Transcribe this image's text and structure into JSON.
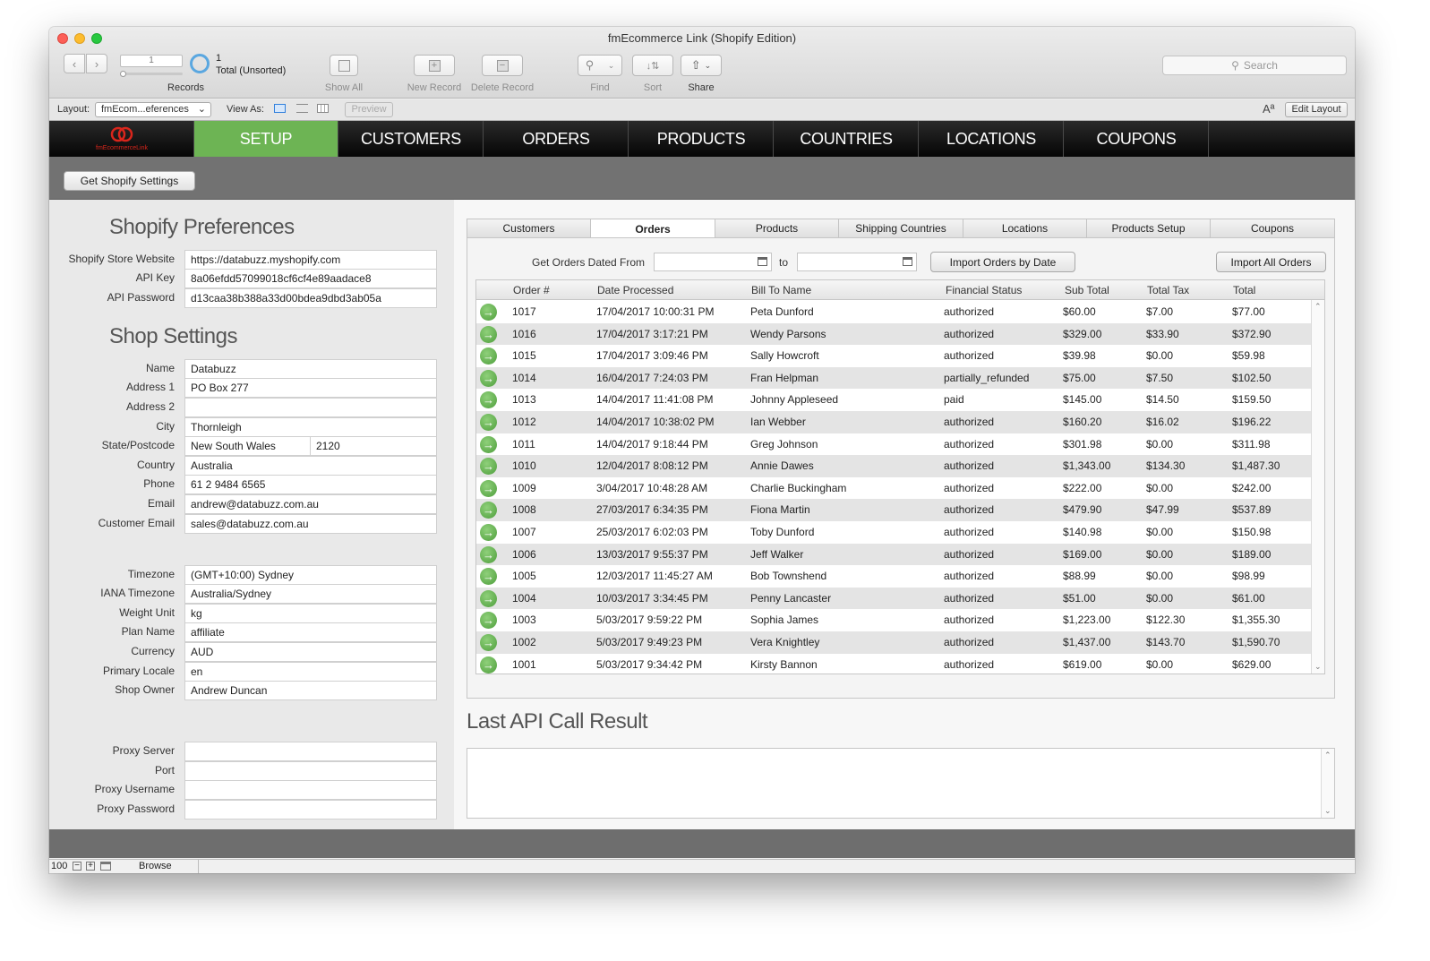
{
  "window": {
    "title": "fmEcommerce Link (Shopify Edition)"
  },
  "toolbar": {
    "record_number": "1",
    "record_count": "1",
    "record_status": "Total (Unsorted)",
    "records_label": "Records",
    "show_all_label": "Show All",
    "new_record_label": "New Record",
    "delete_record_label": "Delete Record",
    "find_label": "Find",
    "sort_label": "Sort",
    "share_label": "Share",
    "search_placeholder": "Search"
  },
  "layoutbar": {
    "layout_label": "Layout:",
    "layout_value": "fmEcom...eferences",
    "view_as_label": "View As:",
    "preview_label": "Preview",
    "text_size_icon": "Aª",
    "edit_layout_label": "Edit Layout"
  },
  "nav": {
    "logo_text": "fmEcommerceLink",
    "tabs": [
      "SETUP",
      "CUSTOMERS",
      "ORDERS",
      "PRODUCTS",
      "COUNTRIES",
      "LOCATIONS",
      "COUPONS"
    ],
    "active_tab": "SETUP",
    "active_color": "#6db454"
  },
  "subbar": {
    "get_settings_label": "Get Shopify Settings"
  },
  "preferences": {
    "heading": "Shopify Preferences",
    "fields": [
      {
        "label": "Shopify Store Website",
        "value": "https://databuzz.myshopify.com"
      },
      {
        "label": "API Key",
        "value": "8a06efdd57099018cf6cf4e89aadace8"
      },
      {
        "label": "API Password",
        "value": "d13caa38b388a33d00bdea9dbd3ab05a"
      }
    ]
  },
  "shop": {
    "heading": "Shop Settings",
    "name": {
      "label": "Name",
      "value": "Databuzz"
    },
    "address1": {
      "label": "Address 1",
      "value": "PO Box 277"
    },
    "address2": {
      "label": "Address 2",
      "value": ""
    },
    "city": {
      "label": "City",
      "value": "Thornleigh"
    },
    "state_label": "State/Postcode",
    "state": "New South Wales",
    "postcode": "2120",
    "country": {
      "label": "Country",
      "value": "Australia"
    },
    "phone": {
      "label": "Phone",
      "value": "61 2 9484 6565"
    },
    "email": {
      "label": "Email",
      "value": "andrew@databuzz.com.au"
    },
    "customer_email": {
      "label": "Customer Email",
      "value": "sales@databuzz.com.au"
    }
  },
  "locale": {
    "fields": [
      {
        "label": "Timezone",
        "value": "(GMT+10:00) Sydney"
      },
      {
        "label": "IANA Timezone",
        "value": "Australia/Sydney"
      },
      {
        "label": "Weight Unit",
        "value": "kg"
      },
      {
        "label": "Plan Name",
        "value": "affiliate"
      },
      {
        "label": "Currency",
        "value": "AUD"
      },
      {
        "label": "Primary Locale",
        "value": "en"
      },
      {
        "label": "Shop Owner",
        "value": "Andrew Duncan"
      }
    ]
  },
  "proxy": {
    "fields": [
      {
        "label": "Proxy Server",
        "value": ""
      },
      {
        "label": "Port",
        "value": ""
      },
      {
        "label": "Proxy Username",
        "value": ""
      },
      {
        "label": "Proxy Password",
        "value": ""
      }
    ]
  },
  "tabs": {
    "items": [
      "Customers",
      "Orders",
      "Products",
      "Shipping Countries",
      "Locations",
      "Products Setup",
      "Coupons"
    ],
    "active": "Orders"
  },
  "orders": {
    "date_from_label": "Get Orders Dated From",
    "date_from_value": "",
    "to_label": "to",
    "date_to_value": "",
    "import_by_date_label": "Import Orders by Date",
    "import_all_label": "Import All Orders",
    "columns": [
      "Order #",
      "Date Processed",
      "Bill To Name",
      "Financial Status",
      "Sub Total",
      "Total Tax",
      "Total"
    ],
    "rows": [
      [
        "1017",
        "17/04/2017 10:00:31 PM",
        "Peta Dunford",
        "authorized",
        "$60.00",
        "$7.00",
        "$77.00"
      ],
      [
        "1016",
        "17/04/2017 3:17:21 PM",
        "Wendy Parsons",
        "authorized",
        "$329.00",
        "$33.90",
        "$372.90"
      ],
      [
        "1015",
        "17/04/2017 3:09:46 PM",
        "Sally Howcroft",
        "authorized",
        "$39.98",
        "$0.00",
        "$59.98"
      ],
      [
        "1014",
        "16/04/2017 7:24:03 PM",
        "Fran Helpman",
        "partially_refunded",
        "$75.00",
        "$7.50",
        "$102.50"
      ],
      [
        "1013",
        "14/04/2017 11:41:08 PM",
        "Johnny Appleseed",
        "paid",
        "$145.00",
        "$14.50",
        "$159.50"
      ],
      [
        "1012",
        "14/04/2017 10:38:02 PM",
        "Ian Webber",
        "authorized",
        "$160.20",
        "$16.02",
        "$196.22"
      ],
      [
        "1011",
        "14/04/2017 9:18:44 PM",
        "Greg Johnson",
        "authorized",
        "$301.98",
        "$0.00",
        "$311.98"
      ],
      [
        "1010",
        "12/04/2017 8:08:12 PM",
        "Annie Dawes",
        "authorized",
        "$1,343.00",
        "$134.30",
        "$1,487.30"
      ],
      [
        "1009",
        "3/04/2017 10:48:28 AM",
        "Charlie Buckingham",
        "authorized",
        "$222.00",
        "$0.00",
        "$242.00"
      ],
      [
        "1008",
        "27/03/2017 6:34:35 PM",
        "Fiona Martin",
        "authorized",
        "$479.90",
        "$47.99",
        "$537.89"
      ],
      [
        "1007",
        "25/03/2017 6:02:03 PM",
        "Toby Dunford",
        "authorized",
        "$140.98",
        "$0.00",
        "$150.98"
      ],
      [
        "1006",
        "13/03/2017 9:55:37 PM",
        "Jeff Walker",
        "authorized",
        "$169.00",
        "$0.00",
        "$189.00"
      ],
      [
        "1005",
        "12/03/2017 11:45:27 AM",
        "Bob Townshend",
        "authorized",
        "$88.99",
        "$0.00",
        "$98.99"
      ],
      [
        "1004",
        "10/03/2017 3:34:45 PM",
        "Penny Lancaster",
        "authorized",
        "$51.00",
        "$0.00",
        "$61.00"
      ],
      [
        "1003",
        "5/03/2017 9:59:22 PM",
        "Sophia James",
        "authorized",
        "$1,223.00",
        "$122.30",
        "$1,355.30"
      ],
      [
        "1002",
        "5/03/2017 9:49:23 PM",
        "Vera Knightley",
        "authorized",
        "$1,437.00",
        "$143.70",
        "$1,590.70"
      ],
      [
        "1001",
        "5/03/2017 9:34:42 PM",
        "Kirsty Bannon",
        "authorized",
        "$619.00",
        "$0.00",
        "$629.00"
      ]
    ]
  },
  "result": {
    "heading": "Last API Call Result",
    "value": ""
  },
  "statusbar": {
    "zoom": "100",
    "mode": "Browse"
  }
}
